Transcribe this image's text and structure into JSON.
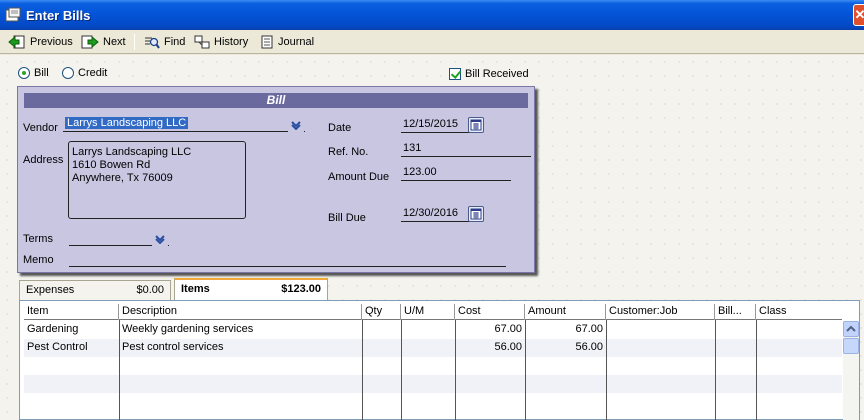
{
  "window": {
    "title": "Enter Bills",
    "close_glyph": "✕"
  },
  "toolbar": {
    "previous": "Previous",
    "next": "Next",
    "find": "Find",
    "history": "History",
    "journal": "Journal"
  },
  "options": {
    "bill_label": "Bill",
    "credit_label": "Credit",
    "bill_received_label": "Bill Received",
    "bill_selected": true,
    "bill_received_checked": true
  },
  "bill": {
    "header": "Bill",
    "vendor_label": "Vendor",
    "vendor": "Larrys Landscaping LLC",
    "address_label": "Address",
    "address_lines": [
      "Larrys Landscaping LLC",
      "1610 Bowen Rd",
      "Anywhere, Tx 76009"
    ],
    "terms_label": "Terms",
    "terms": "",
    "memo_label": "Memo",
    "memo": "",
    "date_label": "Date",
    "date": "12/15/2015",
    "ref_label": "Ref. No.",
    "ref": "131",
    "amount_due_label": "Amount Due",
    "amount_due": "123.00",
    "bill_due_label": "Bill Due",
    "bill_due": "12/30/2016"
  },
  "tabs": [
    {
      "label": "Expenses",
      "amount": "$0.00",
      "active": false
    },
    {
      "label": "Items",
      "amount": "$123.00",
      "active": true
    }
  ],
  "grid": {
    "columns": [
      "Item",
      "Description",
      "Qty",
      "U/M",
      "Cost",
      "Amount",
      "Customer:Job",
      "Bill...",
      "Class"
    ],
    "rows": [
      [
        "Gardening",
        "Weekly gardening services",
        "",
        "",
        "67.00",
        "67.00",
        "",
        "",
        ""
      ],
      [
        "Pest Control",
        "Pest control services",
        "",
        "",
        "56.00",
        "56.00",
        "",
        "",
        ""
      ]
    ]
  },
  "colors": {
    "titlebar": "#0453d6",
    "bill_panel": "#c9c6e2",
    "bill_header": "#6b6a9e",
    "selection": "#316ac5",
    "active_tab_accent": "#f0a93a"
  }
}
